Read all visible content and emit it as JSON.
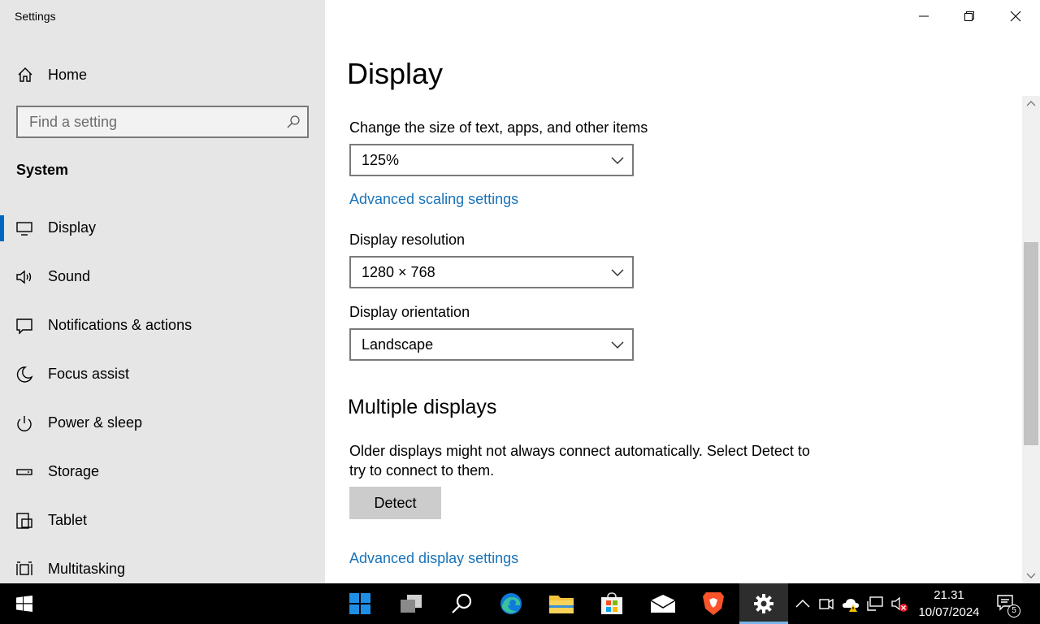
{
  "window": {
    "title": "Settings"
  },
  "sidebar": {
    "home_label": "Home",
    "search_placeholder": "Find a setting",
    "section_title": "System",
    "items": [
      {
        "label": "Display",
        "icon": "monitor-icon",
        "active": true
      },
      {
        "label": "Sound",
        "icon": "speaker-icon"
      },
      {
        "label": "Notifications & actions",
        "icon": "message-icon"
      },
      {
        "label": "Focus assist",
        "icon": "moon-icon"
      },
      {
        "label": "Power & sleep",
        "icon": "power-icon"
      },
      {
        "label": "Storage",
        "icon": "drive-icon"
      },
      {
        "label": "Tablet",
        "icon": "tablet-icon"
      },
      {
        "label": "Multitasking",
        "icon": "multitasking-icon"
      }
    ]
  },
  "main": {
    "title": "Display",
    "scale": {
      "label": "Change the size of text, apps, and other items",
      "value": "125%"
    },
    "advanced_scaling_link": "Advanced scaling settings",
    "resolution": {
      "label": "Display resolution",
      "value": "1280 × 768"
    },
    "orientation": {
      "label": "Display orientation",
      "value": "Landscape"
    },
    "multiple_displays": {
      "heading": "Multiple displays",
      "description": "Older displays might not always connect automatically. Select Detect to try to connect to them.",
      "detect_button": "Detect"
    },
    "advanced_display_link": "Advanced display settings"
  },
  "taskbar": {
    "apps": [
      "start-icon",
      "task-view-icon",
      "search-icon",
      "edge-icon",
      "file-explorer-icon",
      "store-icon",
      "mail-icon",
      "brave-icon",
      "settings-icon"
    ],
    "clock_time": "21.31",
    "clock_date": "10/07/2024",
    "notification_count": "5"
  },
  "colors": {
    "accent": "#0067c0",
    "link": "#1a73b8",
    "sidebar_bg": "#e6e6e6",
    "taskbar_bg": "#000000"
  }
}
